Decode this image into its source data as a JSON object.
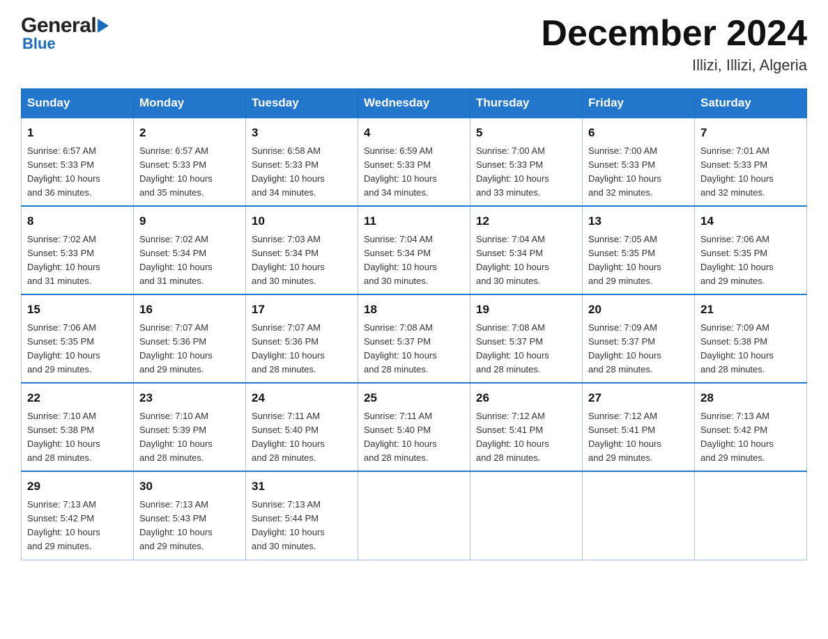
{
  "header": {
    "logo": {
      "general": "General",
      "blue": "Blue"
    },
    "month_title": "December 2024",
    "location": "Illizi, Illizi, Algeria"
  },
  "days_of_week": [
    "Sunday",
    "Monday",
    "Tuesday",
    "Wednesday",
    "Thursday",
    "Friday",
    "Saturday"
  ],
  "weeks": [
    [
      {
        "day": "1",
        "sunrise": "6:57 AM",
        "sunset": "5:33 PM",
        "daylight": "10 hours and 36 minutes."
      },
      {
        "day": "2",
        "sunrise": "6:57 AM",
        "sunset": "5:33 PM",
        "daylight": "10 hours and 35 minutes."
      },
      {
        "day": "3",
        "sunrise": "6:58 AM",
        "sunset": "5:33 PM",
        "daylight": "10 hours and 34 minutes."
      },
      {
        "day": "4",
        "sunrise": "6:59 AM",
        "sunset": "5:33 PM",
        "daylight": "10 hours and 34 minutes."
      },
      {
        "day": "5",
        "sunrise": "7:00 AM",
        "sunset": "5:33 PM",
        "daylight": "10 hours and 33 minutes."
      },
      {
        "day": "6",
        "sunrise": "7:00 AM",
        "sunset": "5:33 PM",
        "daylight": "10 hours and 32 minutes."
      },
      {
        "day": "7",
        "sunrise": "7:01 AM",
        "sunset": "5:33 PM",
        "daylight": "10 hours and 32 minutes."
      }
    ],
    [
      {
        "day": "8",
        "sunrise": "7:02 AM",
        "sunset": "5:33 PM",
        "daylight": "10 hours and 31 minutes."
      },
      {
        "day": "9",
        "sunrise": "7:02 AM",
        "sunset": "5:34 PM",
        "daylight": "10 hours and 31 minutes."
      },
      {
        "day": "10",
        "sunrise": "7:03 AM",
        "sunset": "5:34 PM",
        "daylight": "10 hours and 30 minutes."
      },
      {
        "day": "11",
        "sunrise": "7:04 AM",
        "sunset": "5:34 PM",
        "daylight": "10 hours and 30 minutes."
      },
      {
        "day": "12",
        "sunrise": "7:04 AM",
        "sunset": "5:34 PM",
        "daylight": "10 hours and 30 minutes."
      },
      {
        "day": "13",
        "sunrise": "7:05 AM",
        "sunset": "5:35 PM",
        "daylight": "10 hours and 29 minutes."
      },
      {
        "day": "14",
        "sunrise": "7:06 AM",
        "sunset": "5:35 PM",
        "daylight": "10 hours and 29 minutes."
      }
    ],
    [
      {
        "day": "15",
        "sunrise": "7:06 AM",
        "sunset": "5:35 PM",
        "daylight": "10 hours and 29 minutes."
      },
      {
        "day": "16",
        "sunrise": "7:07 AM",
        "sunset": "5:36 PM",
        "daylight": "10 hours and 29 minutes."
      },
      {
        "day": "17",
        "sunrise": "7:07 AM",
        "sunset": "5:36 PM",
        "daylight": "10 hours and 28 minutes."
      },
      {
        "day": "18",
        "sunrise": "7:08 AM",
        "sunset": "5:37 PM",
        "daylight": "10 hours and 28 minutes."
      },
      {
        "day": "19",
        "sunrise": "7:08 AM",
        "sunset": "5:37 PM",
        "daylight": "10 hours and 28 minutes."
      },
      {
        "day": "20",
        "sunrise": "7:09 AM",
        "sunset": "5:37 PM",
        "daylight": "10 hours and 28 minutes."
      },
      {
        "day": "21",
        "sunrise": "7:09 AM",
        "sunset": "5:38 PM",
        "daylight": "10 hours and 28 minutes."
      }
    ],
    [
      {
        "day": "22",
        "sunrise": "7:10 AM",
        "sunset": "5:38 PM",
        "daylight": "10 hours and 28 minutes."
      },
      {
        "day": "23",
        "sunrise": "7:10 AM",
        "sunset": "5:39 PM",
        "daylight": "10 hours and 28 minutes."
      },
      {
        "day": "24",
        "sunrise": "7:11 AM",
        "sunset": "5:40 PM",
        "daylight": "10 hours and 28 minutes."
      },
      {
        "day": "25",
        "sunrise": "7:11 AM",
        "sunset": "5:40 PM",
        "daylight": "10 hours and 28 minutes."
      },
      {
        "day": "26",
        "sunrise": "7:12 AM",
        "sunset": "5:41 PM",
        "daylight": "10 hours and 28 minutes."
      },
      {
        "day": "27",
        "sunrise": "7:12 AM",
        "sunset": "5:41 PM",
        "daylight": "10 hours and 29 minutes."
      },
      {
        "day": "28",
        "sunrise": "7:13 AM",
        "sunset": "5:42 PM",
        "daylight": "10 hours and 29 minutes."
      }
    ],
    [
      {
        "day": "29",
        "sunrise": "7:13 AM",
        "sunset": "5:42 PM",
        "daylight": "10 hours and 29 minutes."
      },
      {
        "day": "30",
        "sunrise": "7:13 AM",
        "sunset": "5:43 PM",
        "daylight": "10 hours and 29 minutes."
      },
      {
        "day": "31",
        "sunrise": "7:13 AM",
        "sunset": "5:44 PM",
        "daylight": "10 hours and 30 minutes."
      },
      null,
      null,
      null,
      null
    ]
  ],
  "labels": {
    "sunrise": "Sunrise:",
    "sunset": "Sunset:",
    "daylight": "Daylight:"
  }
}
